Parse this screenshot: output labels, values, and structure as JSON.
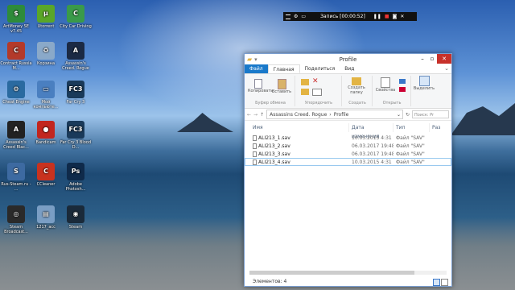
{
  "desktop_icons": [
    {
      "label": "ArtMoney SE v7.45",
      "name": "artmoney-icon",
      "color": "#2e8b3a",
      "glyph": "$"
    },
    {
      "label": "Utorrent",
      "name": "utorrent-icon",
      "color": "#5aa628",
      "glyph": "µ"
    },
    {
      "label": "City Car Driving",
      "name": "city-car-driving-icon",
      "color": "#3a9a4a",
      "glyph": "C"
    },
    {
      "label": "Contract Russia M...",
      "name": "contract-russia-icon",
      "color": "#b33a2a",
      "glyph": "C"
    },
    {
      "label": "Корзина",
      "name": "recycle-bin-icon",
      "color": "#8aa9c9",
      "glyph": "♻"
    },
    {
      "label": "Assassin's Creed. Rogue",
      "name": "ac-rogue-icon",
      "color": "#1b2a44",
      "glyph": "A"
    },
    {
      "label": "Cheat Engine",
      "name": "cheat-engine-icon",
      "color": "#2a6aa0",
      "glyph": "⚙"
    },
    {
      "label": "Мой компьюте...",
      "name": "my-computer-icon",
      "color": "#4a7fc0",
      "glyph": "▭"
    },
    {
      "label": "Far Cry 3",
      "name": "far-cry-3-icon",
      "color": "#1a3a5a",
      "glyph": "FC3"
    },
    {
      "label": "Assassin's Creed Blac...",
      "name": "ac-black-flag-icon",
      "color": "#222",
      "glyph": "A"
    },
    {
      "label": "Bandicam",
      "name": "bandicam-icon",
      "color": "#c2261f",
      "glyph": "●"
    },
    {
      "label": "Far Cry 3 Blood D...",
      "name": "far-cry-3-blood-dragon-icon",
      "color": "#1a3a5a",
      "glyph": "FC3"
    },
    {
      "label": "Rus-Steam.ru - ...",
      "name": "rus-steam-icon",
      "color": "#3d6aa1",
      "glyph": "S"
    },
    {
      "label": "CCleaner",
      "name": "ccleaner-icon",
      "color": "#c8321f",
      "glyph": "C"
    },
    {
      "label": "Adobe Photosh...",
      "name": "photoshop-icon",
      "color": "#0f2a4a",
      "glyph": "Ps"
    },
    {
      "label": "Steam Broadcast...",
      "name": "steam-broadcast-icon",
      "color": "#2a2a2a",
      "glyph": "◎"
    },
    {
      "label": "1217_аcc",
      "name": "folder-1217-icon",
      "color": "#7a9ec4",
      "glyph": "▤"
    },
    {
      "label": "Steam",
      "name": "steam-icon",
      "color": "#1a2a3a",
      "glyph": "◉"
    }
  ],
  "recorder": {
    "text": "Запись [00:00:52]"
  },
  "window": {
    "title": "Profile",
    "tabs": [
      "Файл",
      "Главная",
      "Поделиться",
      "Вид"
    ],
    "ribbon": {
      "clipboard": {
        "copy": "Копировать",
        "paste": "Вставить",
        "group": "Буфер обмена"
      },
      "organize": {
        "group": "Упорядочить"
      },
      "create": {
        "new_folder": "Создать папку",
        "group": "Создать"
      },
      "open": {
        "properties": "Свойства",
        "group": "Открыть"
      },
      "select": {
        "select": "Выделить"
      }
    },
    "address": {
      "path": [
        "Assassins Creed. Rogue",
        "Profile"
      ],
      "search_placeholder": "Поиск: Pr"
    },
    "columns": [
      "Имя",
      "Дата изменения",
      "Тип",
      "Раз"
    ],
    "files": [
      {
        "name": "ALI213_1.sav",
        "date": "10.03.2015 4:31",
        "type": "Файл \"SAV\""
      },
      {
        "name": "ALI213_2.sav",
        "date": "06.03.2017 19:48",
        "type": "Файл \"SAV\""
      },
      {
        "name": "ALI213_3.sav",
        "date": "06.03.2017 19:48",
        "type": "Файл \"SAV\""
      },
      {
        "name": "ALI213_4.sav",
        "date": "10.03.2015 4:31",
        "type": "Файл \"SAV\""
      }
    ],
    "status": "Элементов: 4"
  }
}
